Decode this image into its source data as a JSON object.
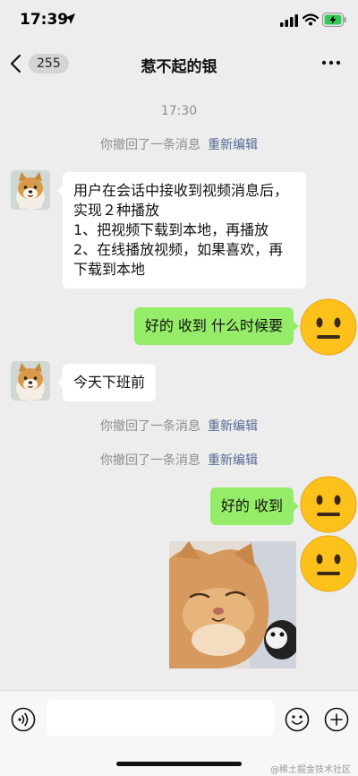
{
  "status_bar": {
    "time": "17:39"
  },
  "nav": {
    "unread_count": "255",
    "title": "惹不起的银"
  },
  "chat": {
    "time_label": "17:30",
    "recall_notes": [
      {
        "text": "你撤回了一条消息",
        "link": "重新编辑"
      },
      {
        "text": "你撤回了一条消息",
        "link": "重新编辑"
      },
      {
        "text": "你撤回了一条消息",
        "link": "重新编辑"
      }
    ],
    "messages": [
      {
        "from": "them",
        "text": "用户在会话中接收到视频消息后，实现２种播放\n1、把视频下载到本地，再播放\n2、在线播放视频，如果喜欢，再下载到本地"
      },
      {
        "from": "me",
        "text": "好的 收到 什么时候要"
      },
      {
        "from": "them",
        "text": "今天下班前"
      },
      {
        "from": "me",
        "text": "好的 收到"
      },
      {
        "from": "me",
        "type": "image",
        "icon": "cat-photo"
      }
    ]
  },
  "watermark": "@稀土掘金技术社区",
  "colors": {
    "outgoing_bubble": "#95ec69",
    "incoming_bubble": "#ffffff",
    "link": "#576b95",
    "background": "#ededed"
  }
}
